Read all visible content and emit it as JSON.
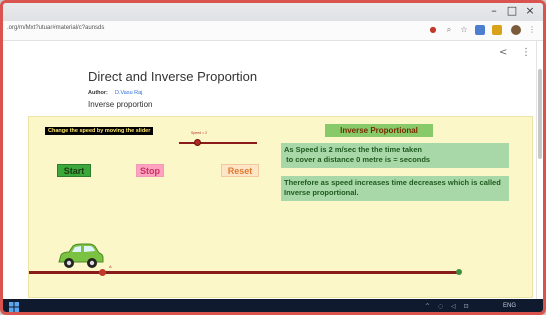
{
  "browser": {
    "url": ".org/m/Mxt?utuar#material/c?aunsds",
    "window_controls": {
      "minimize": "–",
      "maximize": "□",
      "close": "×"
    }
  },
  "page": {
    "title": "Direct and Inverse Proportion",
    "author_label": "Author:",
    "author_name": "D.Vasu Raj",
    "subtitle": "Inverse proportion",
    "share_icon": "<",
    "more_icon": "⋮"
  },
  "applet": {
    "hint": "Change the speed by moving the slider",
    "slider_label": "Speed = 2",
    "speed_value": 2,
    "buttons": {
      "start": "Start",
      "stop": "Stop",
      "reset": "Reset"
    },
    "heading": "Inverse Proportional",
    "info1": "As Speed is 2 m/sec the the time taken\n to cover a distance 0 metre is = seconds",
    "info2": "Therefore as speed increases time decreases which is called Inverse proportional.",
    "track_label": "A",
    "colors": {
      "background": "#fcf7c8",
      "track": "#8b1a1a",
      "car": "#7cc242",
      "info_box": "#a8d8a8"
    }
  },
  "taskbar": {
    "tray_icons": "^ ◌ ◁ ⊡",
    "time": "ENG"
  }
}
